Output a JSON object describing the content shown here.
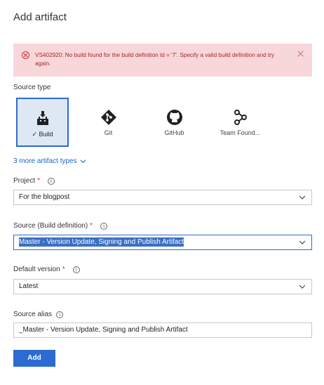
{
  "dialog": {
    "title": "Add artifact"
  },
  "error": {
    "message": "VS402920: No build found for the build definition Id = '7'. Specify a valid build definition and try again."
  },
  "source_type": {
    "label": "Source type",
    "tiles": [
      {
        "label": "Build",
        "icon": "build-icon",
        "selected": true
      },
      {
        "label": "Git",
        "icon": "git-icon"
      },
      {
        "label": "GitHub",
        "icon": "github-icon"
      },
      {
        "label": "Team Found...",
        "icon": "tfvc-icon"
      }
    ],
    "more_link": "3 more artifact types"
  },
  "project": {
    "label": "Project",
    "value": "For the blogpost"
  },
  "source": {
    "label": "Source (Build definition)",
    "value": "Master - Version Update, Signing and Publish Artifact"
  },
  "default_version": {
    "label": "Default version",
    "value": "Latest"
  },
  "source_alias": {
    "label": "Source alias",
    "value": "_Master - Version Update, Signing and Publish Artifact"
  },
  "actions": {
    "add_label": "Add"
  },
  "colors": {
    "accent": "#2c6bd1",
    "error_bg": "#f8d7da",
    "error_text": "#a4262c",
    "required": "#c8363b"
  }
}
